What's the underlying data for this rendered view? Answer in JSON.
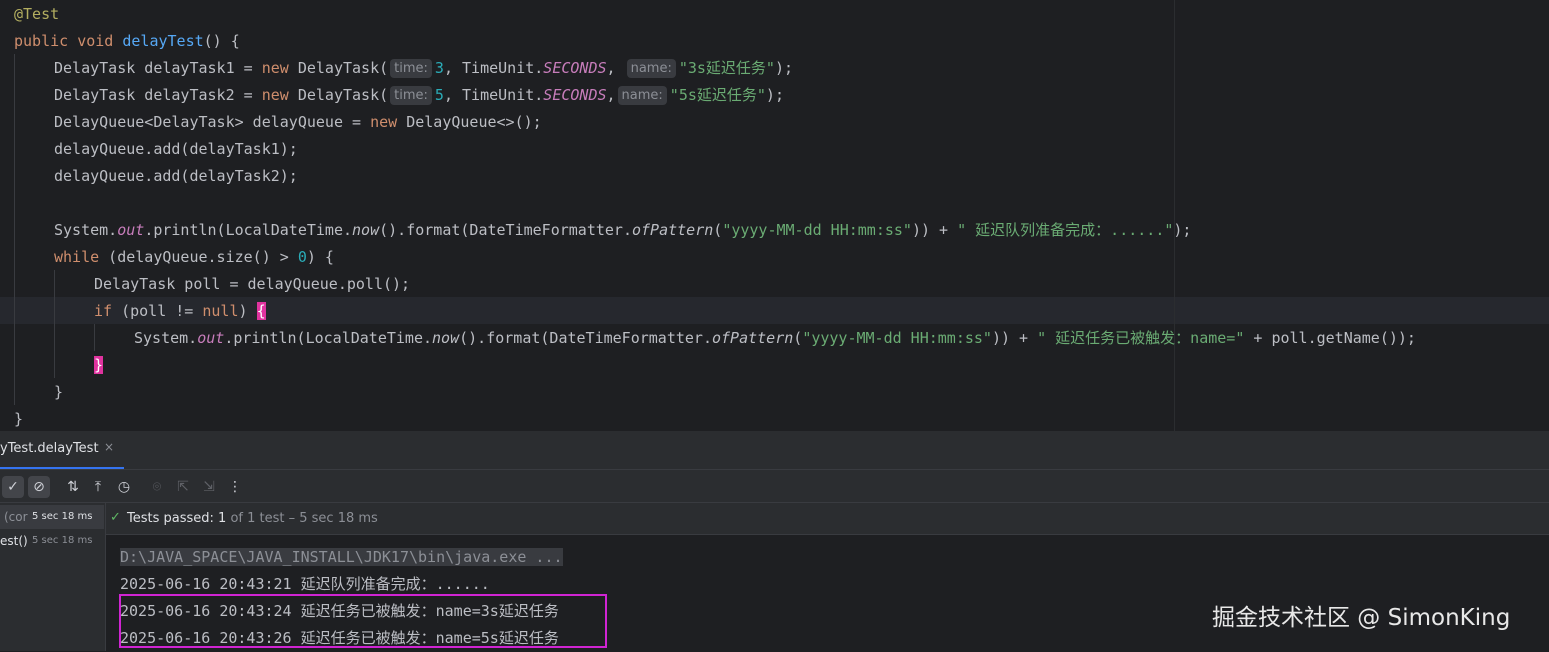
{
  "editor": {
    "lines": {
      "l1_annotation": "@Test",
      "l2_public": "public",
      "l2_void": "void",
      "l2_method": "delayTest",
      "l2_rest": "() {",
      "l3_pre": "DelayTask delayTask1 = ",
      "l3_new": "new",
      "l3_cls": " DelayTask(",
      "l3_hint_time": "time:",
      "l3_num": "3",
      "l3_mid": ", TimeUnit.",
      "l3_const": "SECONDS",
      "l3_comma": ",",
      "l3_hint_name": "name:",
      "l3_str": "\"3s延迟任务\"",
      "l3_end": ");",
      "l4_pre": "DelayTask delayTask2 = ",
      "l4_new": "new",
      "l4_cls": " DelayTask(",
      "l4_hint_time": "time:",
      "l4_num": "5",
      "l4_mid": ", TimeUnit.",
      "l4_const": "SECONDS",
      "l4_comma": ",",
      "l4_hint_name": "name:",
      "l4_str": "\"5s延迟任务\"",
      "l4_end": ");",
      "l5_pre": "DelayQueue<DelayTask> delayQueue = ",
      "l5_new": "new",
      "l5_end": " DelayQueue<>();",
      "l6": "delayQueue.add(delayTask1);",
      "l7": "delayQueue.add(delayTask2);",
      "l9_a": "System.",
      "l9_out": "out",
      "l9_b": ".println(LocalDateTime.",
      "l9_now": "now",
      "l9_c": "().format(DateTimeFormatter.",
      "l9_of": "ofPattern",
      "l9_d": "(",
      "l9_str1": "\"yyyy-MM-dd HH:mm:ss\"",
      "l9_e": ")) + ",
      "l9_str2": "\" 延迟队列准备完成：......\"",
      "l9_f": ");",
      "l10_while": "while",
      "l10_a": " (delayQueue.size() > ",
      "l10_num": "0",
      "l10_b": ") {",
      "l11": "DelayTask poll = delayQueue.poll();",
      "l12_if": "if",
      "l12_a": " (poll != ",
      "l12_null": "null",
      "l12_b": ") ",
      "l12_brace": "{",
      "l13_a": "System.",
      "l13_out": "out",
      "l13_b": ".println(LocalDateTime.",
      "l13_now": "now",
      "l13_c": "().format(DateTimeFormatter.",
      "l13_of": "ofPattern",
      "l13_d": "(",
      "l13_str1": "\"yyyy-MM-dd HH:mm:ss\"",
      "l13_e": ")) + ",
      "l13_str2": "\" 延迟任务已被触发：name=\"",
      "l13_f": " + poll.getName());",
      "l14_brace": "}",
      "l15": "}",
      "l16": "}"
    }
  },
  "run_panel": {
    "tab_label": "yTest.delayTest",
    "tab_close": "×",
    "toolbar": {
      "check": "✓",
      "stop": "⊘",
      "sort": "⇅",
      "collapse": "⤒",
      "history": "◷",
      "camera": "⌾",
      "export": "⇱",
      "import": "⇲",
      "more": "⋮"
    },
    "tree": [
      {
        "name": "(cor",
        "time": "5 sec 18 ms"
      },
      {
        "name": "est()",
        "time": "5 sec 18 ms"
      }
    ],
    "status": {
      "check": "✓",
      "passed_label": "Tests passed: 1",
      "detail": " of 1 test – 5 sec 18 ms"
    },
    "console": {
      "command": "D:\\JAVA_SPACE\\JAVA_INSTALL\\JDK17\\bin\\java.exe ...",
      "line1": "2025-06-16 20:43:21 延迟队列准备完成：......",
      "line2": "2025-06-16 20:43:24 延迟任务已被触发：name=3s延迟任务",
      "line3": "2025-06-16 20:43:26 延迟任务已被触发：name=5s延迟任务"
    }
  },
  "watermark": "掘金技术社区 @ SimonKing",
  "colors": {
    "keyword": "#cf8e6d",
    "function": "#56a8f5",
    "string": "#6aab73",
    "number": "#2aacb8",
    "static_field": "#c77dbb",
    "highlight_box": "#d024d3",
    "brace_match": "#e0339f"
  }
}
